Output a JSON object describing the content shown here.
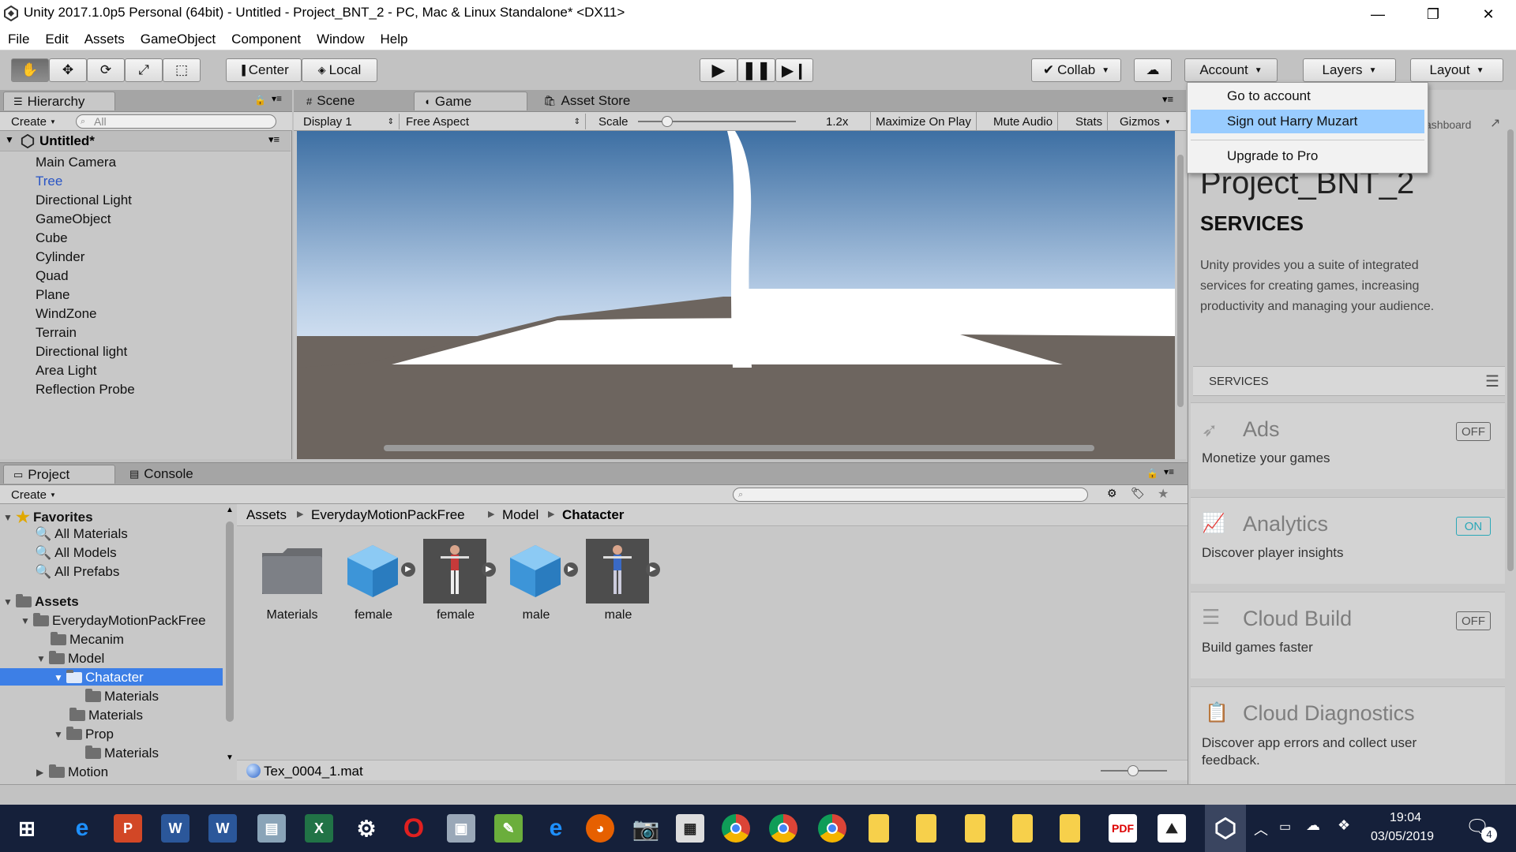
{
  "window": {
    "title": "Unity 2017.1.0p5 Personal (64bit) - Untitled - Project_BNT_2 - PC, Mac & Linux Standalone* <DX11>",
    "controls": {
      "minimize": "—",
      "maximize": "❐",
      "close": "✕"
    }
  },
  "menu": [
    "File",
    "Edit",
    "Assets",
    "GameObject",
    "Component",
    "Window",
    "Help"
  ],
  "toolbar": {
    "pivot": "Center",
    "space": "Local",
    "collab": "Collab",
    "account": "Account",
    "layers": "Layers",
    "layout": "Layout"
  },
  "hierarchy": {
    "tab": "Hierarchy",
    "create": "Create",
    "search_placeholder": "All",
    "scene": "Untitled*",
    "items": [
      "Main Camera",
      "Tree",
      "Directional Light",
      "GameObject",
      "Cube",
      "Cylinder",
      "Quad",
      "Plane",
      "WindZone",
      "Terrain",
      "Directional light",
      "Area Light",
      "Reflection Probe"
    ],
    "selected_color": "#2854c5"
  },
  "viewport": {
    "tabs": [
      "Scene",
      "Game",
      "Asset Store"
    ],
    "display": "Display 1",
    "aspect": "Free Aspect",
    "scale_label": "Scale",
    "scale_value": "1.2x",
    "maximize": "Maximize On Play",
    "mute": "Mute Audio",
    "stats": "Stats",
    "gizmos": "Gizmos"
  },
  "account_menu": {
    "items": [
      "Go to account",
      "Sign out Harry Muzart",
      "Upgrade to Pro"
    ],
    "highlight_color": "#99ccff"
  },
  "services": {
    "dashboard": "ashboard",
    "project": "Project_BNT_2",
    "heading": "SERVICES",
    "intro": "Unity provides you a suite of integrated services for creating games, increasing productivity and managing your audience.",
    "section": "SERVICES",
    "cards": [
      {
        "name": "Ads",
        "desc": "Monetize your games",
        "state": "OFF"
      },
      {
        "name": "Analytics",
        "desc": "Discover player insights",
        "state": "ON"
      },
      {
        "name": "Cloud Build",
        "desc": "Build games faster",
        "state": "OFF"
      },
      {
        "name": "Cloud Diagnostics",
        "desc": "Discover app errors and collect user feedback."
      }
    ]
  },
  "project": {
    "tabs": [
      "Project",
      "Console"
    ],
    "create": "Create",
    "favorites": "Favorites",
    "favorites_items": [
      "All Materials",
      "All Models",
      "All Prefabs"
    ],
    "assets_root": "Assets",
    "tree": [
      "EverydayMotionPackFree",
      "Mecanim",
      "Model",
      "Chatacter",
      "Materials",
      "Materials",
      "Prop",
      "Materials",
      "Motion"
    ],
    "breadcrumb": [
      "Assets",
      "EverydayMotionPackFree",
      "Model",
      "Chatacter"
    ],
    "assets": [
      "Materials",
      "female",
      "female",
      "male",
      "male"
    ],
    "status": "Tex_0004_1.mat",
    "selection_color": "#3d7fe6"
  },
  "taskbar": {
    "time": "19:04",
    "date": "03/05/2019",
    "notifications": "4"
  }
}
